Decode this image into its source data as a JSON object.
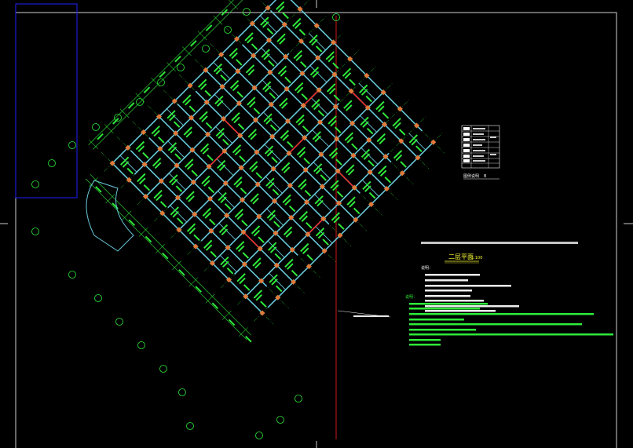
{
  "colors": {
    "background": "#000000",
    "grid_axis": "#2eea3a",
    "beam": "#67c8d8",
    "column": "#e07a3a",
    "wall_red": "#ff2020",
    "note_text": "#f4f4f4",
    "green_note": "#2eea3a",
    "title_yellow": "#ffff33",
    "viewport_blue": "#2020ff",
    "crosshair": "#ffffff",
    "frame": "#cfcfcf"
  },
  "drawing": {
    "plan_title": "二层平面",
    "scale_label": "1:100",
    "notes_heading": "说明：",
    "notes_heading2": "说明：",
    "legend_title": "图例说明",
    "legend_mark": "B"
  },
  "axis_bubbles": [
    "A",
    "B",
    "C",
    "D",
    "E",
    "F",
    "G",
    "H",
    "J",
    "K",
    "L",
    "M",
    "N"
  ]
}
